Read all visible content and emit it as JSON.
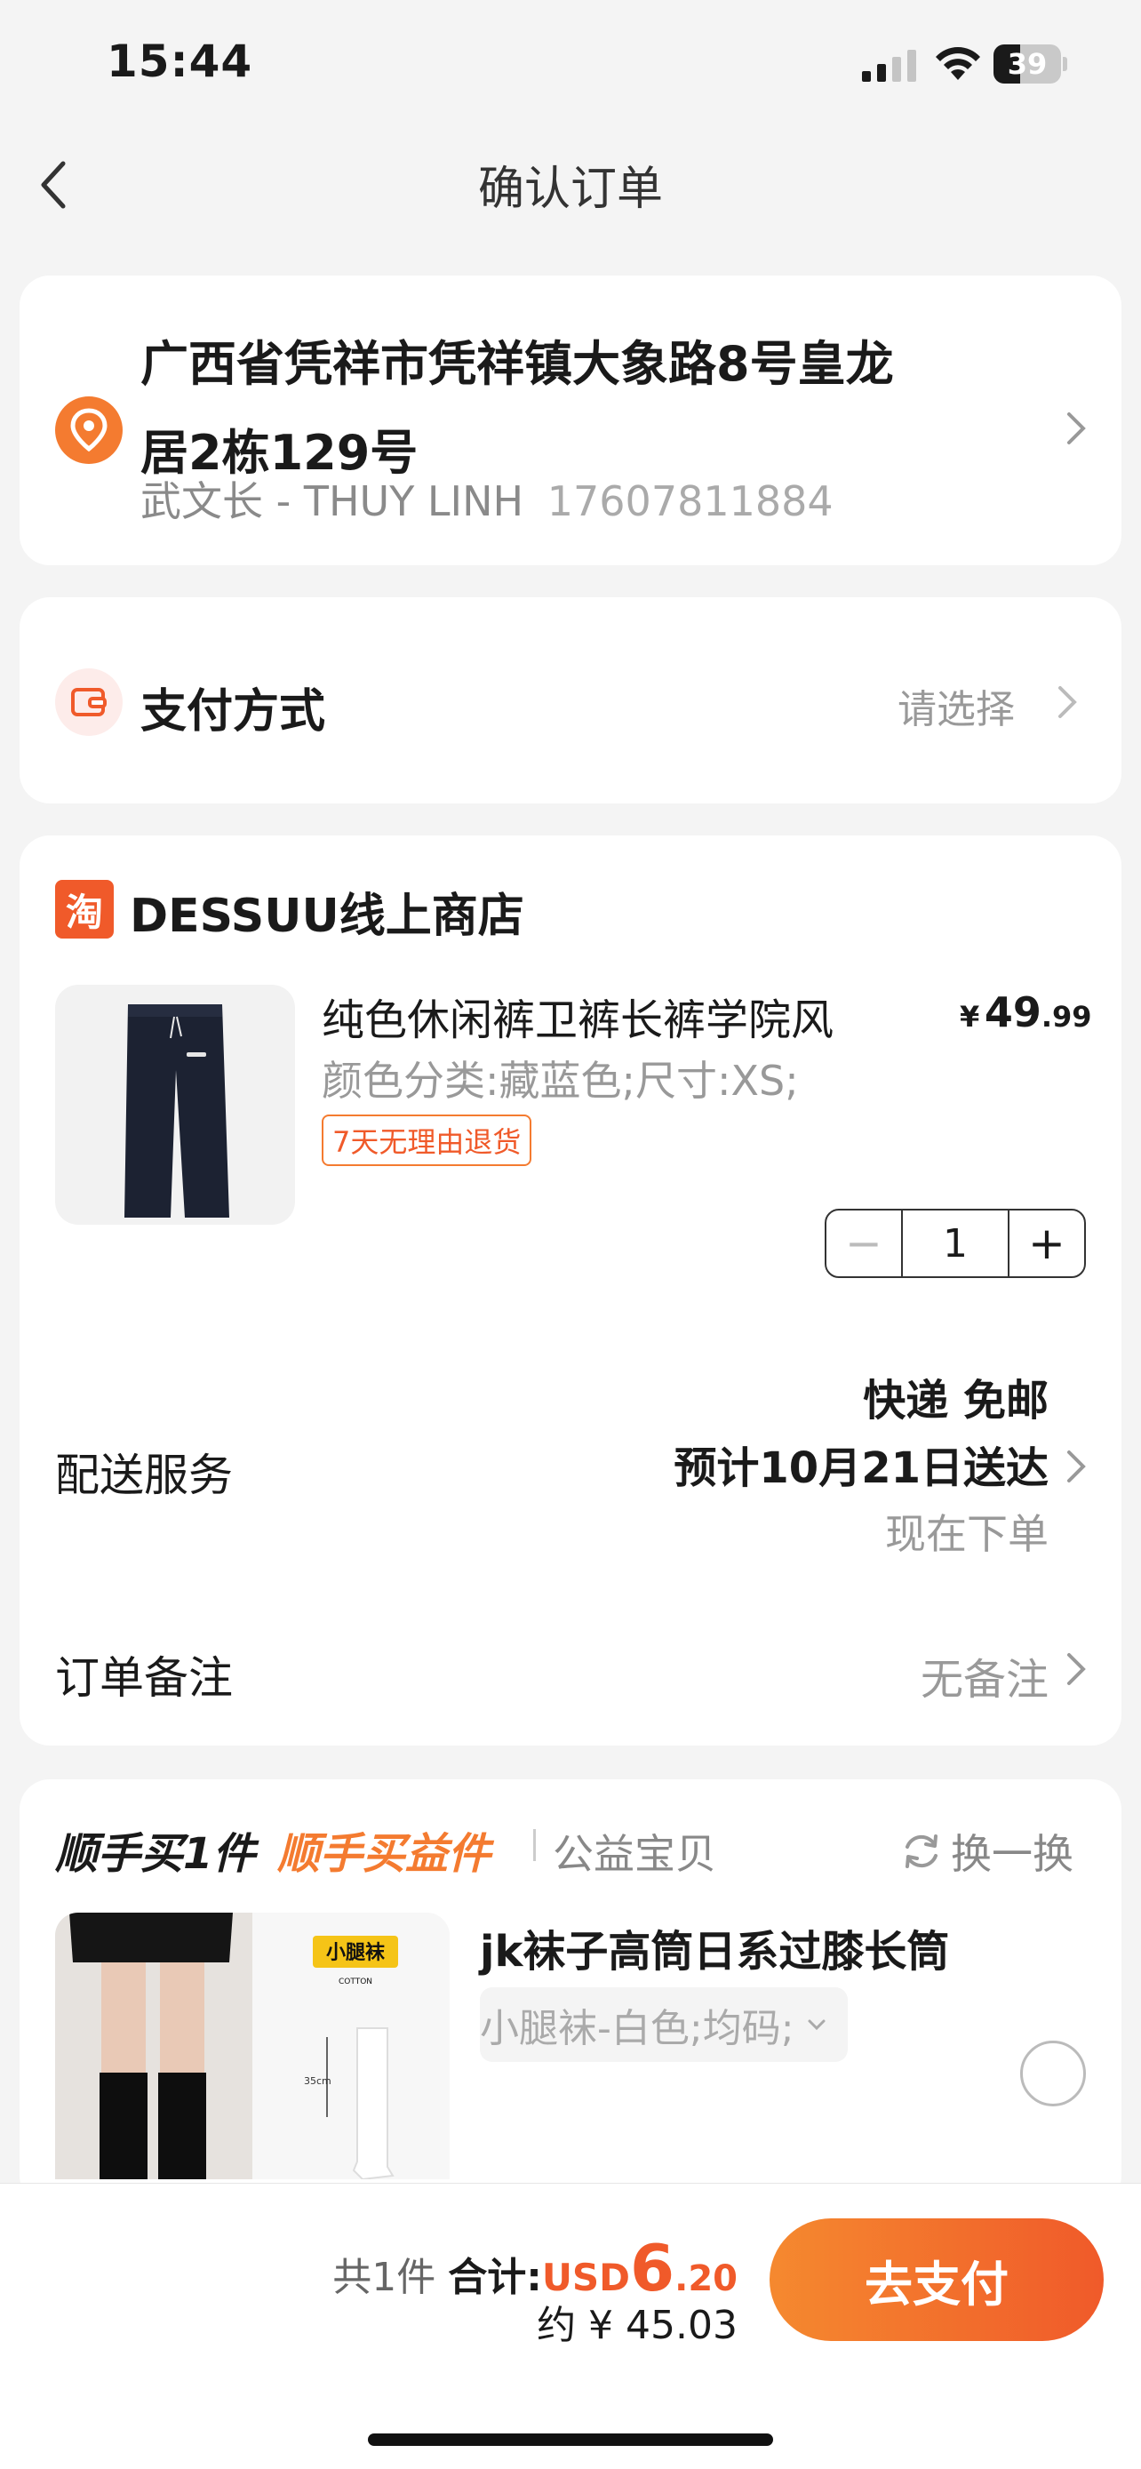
{
  "status_bar": {
    "time": "15:44",
    "battery": "39"
  },
  "header": {
    "title": "确认订单"
  },
  "address": {
    "line1": "广西省凭祥市凭祥镇大象路8号皇龙",
    "line2": "居2栋129号",
    "contact_name": "武文长 - THUY LINH",
    "phone": "17607811884"
  },
  "payment": {
    "label": "支付方式",
    "placeholder": "请选择"
  },
  "shop": {
    "logo_char": "淘",
    "name": "DESSUU线上商店"
  },
  "product": {
    "title": "纯色休闲裤卫裤长裤学院风",
    "spec": "颜色分类:藏蓝色;尺寸:XS;",
    "tag": "7天无理由退货",
    "price_currency": "¥",
    "price_int": "49",
    "price_dec": ".99",
    "quantity": "1"
  },
  "shipping": {
    "label": "配送服务",
    "line1": "快递 免邮",
    "line2": "预计10月21日送达",
    "line3": "现在下单"
  },
  "note": {
    "label": "订单备注",
    "value": "无备注"
  },
  "recommend": {
    "title1": "顺手买1件",
    "title2": "顺手买益件",
    "charity": "公益宝贝",
    "swap": "换一换",
    "item_name": "jk袜子高筒日系过膝长筒",
    "item_spec": "小腿袜-白色;均码;",
    "img_badge": "小腿袜",
    "img_badge_sub": "COTTON",
    "img_size": "35cm"
  },
  "checkout": {
    "count": "共1件",
    "total_label": "合计:",
    "currency": "USD",
    "total_int": "6",
    "total_dec": ".20",
    "approx": "约 ¥ 45.03",
    "pay_button": "去支付"
  },
  "colors": {
    "accent": "#f05a2a",
    "accent_light": "#f5892f"
  }
}
